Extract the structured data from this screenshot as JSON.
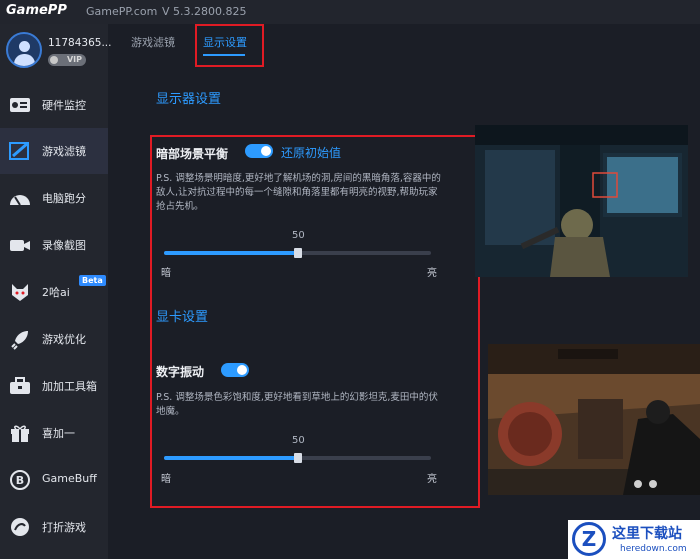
{
  "titlebar": {
    "logo": "GamePP",
    "site": "GamePP.com",
    "version": "V 5.3.2800.825"
  },
  "user": {
    "id": "11784365...",
    "vip": "VIP"
  },
  "sidebar": {
    "items": [
      {
        "label": "硬件监控",
        "icon": "monitor-icon"
      },
      {
        "label": "游戏滤镜",
        "icon": "filter-icon",
        "active": true
      },
      {
        "label": "电脑跑分",
        "icon": "speedometer-icon"
      },
      {
        "label": "录像截图",
        "icon": "camera-icon"
      },
      {
        "label": "2哈ai",
        "icon": "husky-icon",
        "badge": "Beta"
      },
      {
        "label": "游戏优化",
        "icon": "rocket-icon"
      },
      {
        "label": "加加工具箱",
        "icon": "toolbox-icon"
      },
      {
        "label": "喜加一",
        "icon": "gift-icon"
      },
      {
        "label": "GameBuff",
        "icon": "gamebuff-icon"
      },
      {
        "label": "打折游戏",
        "icon": "discount-icon"
      }
    ]
  },
  "tabs": [
    {
      "label": "游戏滤镜",
      "active": false
    },
    {
      "label": "显示设置",
      "active": true
    }
  ],
  "monitor_section": {
    "title": "显示器设置"
  },
  "dark_balance": {
    "label": "暗部场景平衡",
    "enabled": true,
    "reset_label": "还原初始值",
    "desc": "P.S. 调整场景明暗度,更好地了解机场的洞,房间的黑暗角落,容器中的敌人,让对抗过程中的每一个缝隙和角落里都有明亮的视野,帮助玩家抢占先机。",
    "value": "50",
    "value_fraction": 0.5,
    "min_label": "暗",
    "max_label": "亮"
  },
  "gpu_section": {
    "title": "显卡设置"
  },
  "digital_vibrance": {
    "label": "数字振动",
    "enabled": true,
    "desc": "P.S. 调整场景色彩饱和度,更好地看到草地上的幻影坦克,麦田中的伏地魔。",
    "value": "50",
    "value_fraction": 0.5,
    "min_label": "暗",
    "max_label": "亮"
  },
  "watermark": {
    "title": "这里下载站",
    "url": "heredown.com"
  },
  "colors": {
    "accent": "#2d9bff",
    "highlight_box": "#e01b24",
    "background": "#1b1e26",
    "sidebar": "#23262e"
  }
}
